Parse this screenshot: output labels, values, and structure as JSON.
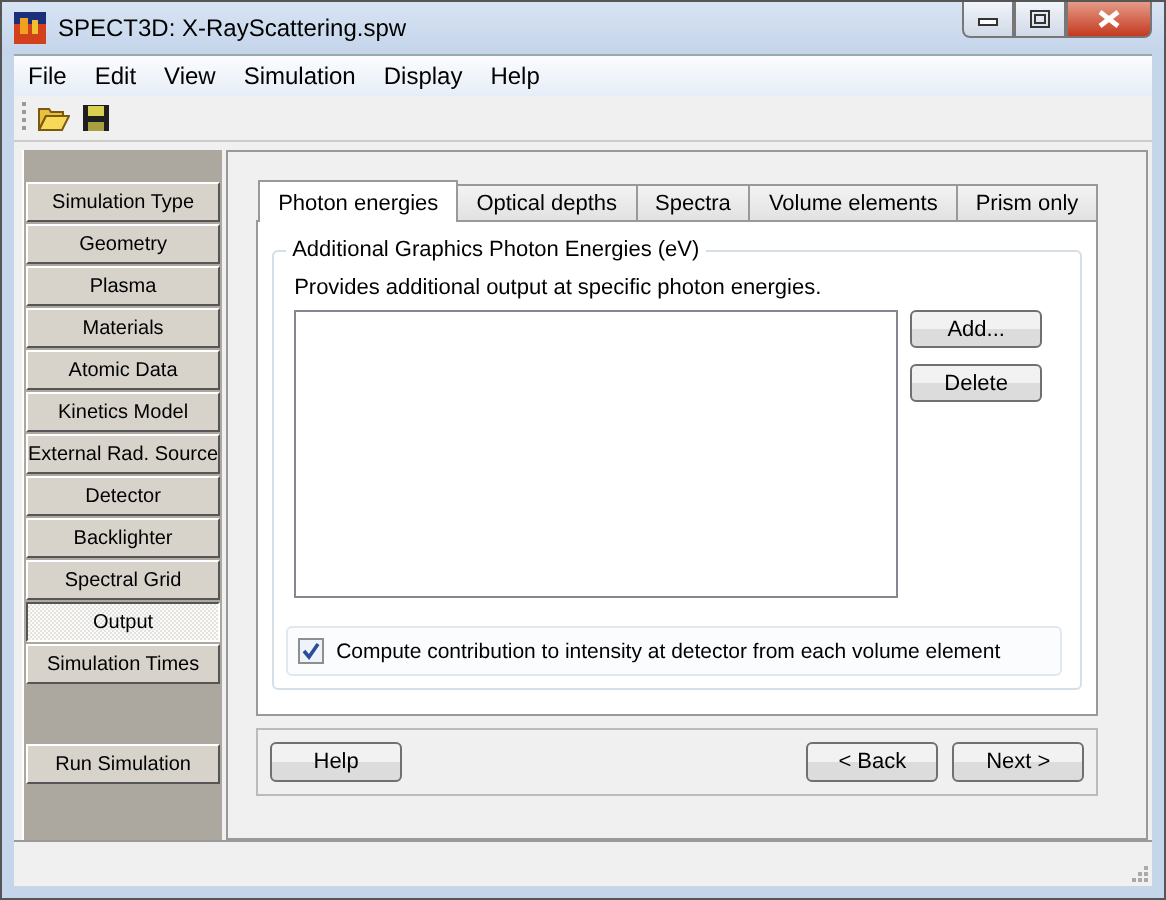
{
  "window": {
    "title": "SPECT3D:  X-RayScattering.spw"
  },
  "menu": [
    "File",
    "Edit",
    "View",
    "Simulation",
    "Display",
    "Help"
  ],
  "sidebar": {
    "items": [
      {
        "label": "Simulation Type",
        "selected": false
      },
      {
        "label": "Geometry",
        "selected": false
      },
      {
        "label": "Plasma",
        "selected": false
      },
      {
        "label": "Materials",
        "selected": false
      },
      {
        "label": "Atomic Data",
        "selected": false
      },
      {
        "label": "Kinetics Model",
        "selected": false
      },
      {
        "label": "External Rad. Source",
        "selected": false
      },
      {
        "label": "Detector",
        "selected": false
      },
      {
        "label": "Backlighter",
        "selected": false
      },
      {
        "label": "Spectral Grid",
        "selected": false
      },
      {
        "label": "Output",
        "selected": true
      },
      {
        "label": "Simulation Times",
        "selected": false
      }
    ],
    "run_button": "Run Simulation"
  },
  "tabs": [
    {
      "label": "Photon energies",
      "selected": true
    },
    {
      "label": "Optical depths",
      "selected": false
    },
    {
      "label": "Spectra",
      "selected": false
    },
    {
      "label": "Volume elements",
      "selected": false
    },
    {
      "label": "Prism only",
      "selected": false
    }
  ],
  "group": {
    "title": "Additional Graphics Photon Energies (eV)",
    "description": "Provides additional output at specific photon energies.",
    "buttons": [
      "Add...",
      "Delete"
    ]
  },
  "checkbox": {
    "label": "Compute contribution to intensity at detector from each volume element",
    "checked": true
  },
  "footer_buttons": {
    "left": "Help",
    "right": [
      "< Back",
      "Next >"
    ]
  }
}
